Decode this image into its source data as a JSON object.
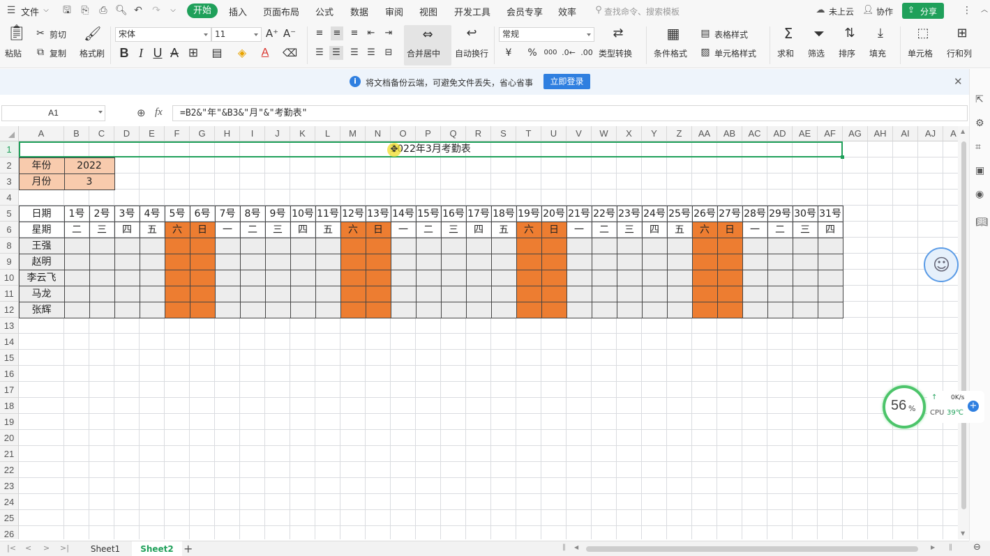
{
  "menu": {
    "file_label": "文件",
    "tabs": [
      "开始",
      "插入",
      "页面布局",
      "公式",
      "数据",
      "审阅",
      "视图",
      "开发工具",
      "会员专享",
      "效率"
    ],
    "active_tab": "开始",
    "search_placeholder": "查找命令、搜索模板",
    "cloud_label": "未上云",
    "collab_label": "协作",
    "share_label": "分享"
  },
  "ribbon": {
    "paste": "粘贴",
    "cut": "剪切",
    "copy": "复制",
    "format_painter": "格式刷",
    "font_name": "宋体",
    "font_size": "11",
    "merge_center": "合并居中",
    "wrap_text": "自动换行",
    "number_format": "常规",
    "type_convert": "类型转换",
    "conditional_format": "条件格式",
    "table_style": "表格样式",
    "cell_style": "单元格样式",
    "sum": "求和",
    "filter": "筛选",
    "sort": "排序",
    "fill": "填充",
    "cell": "单元格",
    "row_col": "行和列",
    "bold": "B",
    "italic": "I",
    "underline": "U",
    "strikethrough": "A",
    "font_color": "A",
    "currency": "¥",
    "percent": "%",
    "thousands": "000"
  },
  "notice": {
    "text": "将文档备份云端，可避免文件丢失，省心省事",
    "button": "立即登录"
  },
  "formula_bar": {
    "name_box": "A1",
    "fx": "fx",
    "formula": "=B2&\"年\"&B3&\"月\"&\"考勤表\""
  },
  "columns": [
    "A",
    "B",
    "C",
    "D",
    "E",
    "F",
    "G",
    "H",
    "I",
    "J",
    "K",
    "L",
    "M",
    "N",
    "O",
    "P",
    "Q",
    "R",
    "S",
    "T",
    "U",
    "V",
    "W",
    "X",
    "Y",
    "Z",
    "AA",
    "AB",
    "AC",
    "AD",
    "AE",
    "AF",
    "AG",
    "AH",
    "AI",
    "AJ",
    "A"
  ],
  "rows": [
    "1",
    "2",
    "3",
    "4",
    "5",
    "6",
    "8",
    "9",
    "10",
    "11",
    "12",
    "13",
    "14",
    "15",
    "16",
    "17",
    "18",
    "19",
    "20",
    "21",
    "22",
    "23",
    "24",
    "25",
    "26"
  ],
  "sheet": {
    "title": "2022年3月考勤表",
    "year_label": "年份",
    "year_value": "2022",
    "month_label": "月份",
    "month_value": "3",
    "date_label": "日期",
    "week_label": "星期",
    "days": [
      "1号",
      "2号",
      "3号",
      "4号",
      "5号",
      "6号",
      "7号",
      "8号",
      "9号",
      "10号",
      "11号",
      "12号",
      "13号",
      "14号",
      "15号",
      "16号",
      "17号",
      "18号",
      "19号",
      "20号",
      "21号",
      "22号",
      "23号",
      "24号",
      "25号",
      "26号",
      "27号",
      "28号",
      "29号",
      "30号",
      "31号"
    ],
    "weekdays": [
      "二",
      "三",
      "四",
      "五",
      "六",
      "日",
      "一",
      "二",
      "三",
      "四",
      "五",
      "六",
      "日",
      "一",
      "二",
      "三",
      "四",
      "五",
      "六",
      "日",
      "一",
      "二",
      "三",
      "四",
      "五",
      "六",
      "日",
      "一",
      "二",
      "三",
      "四"
    ],
    "names": [
      "王强",
      "赵明",
      "李云飞",
      "马龙",
      "张辉"
    ]
  },
  "widget": {
    "percent": "56",
    "percent_sign": "%",
    "net": "0K/s",
    "cpu_label": "CPU",
    "cpu_temp": "39℃"
  },
  "sheets": [
    "Sheet1",
    "Sheet2"
  ],
  "active_sheet": "Sheet2",
  "colors": {
    "accent": "#1fa05a",
    "weekend": "#ed7d31",
    "label_fill": "#f8cbad",
    "body_fill": "#ededed"
  }
}
